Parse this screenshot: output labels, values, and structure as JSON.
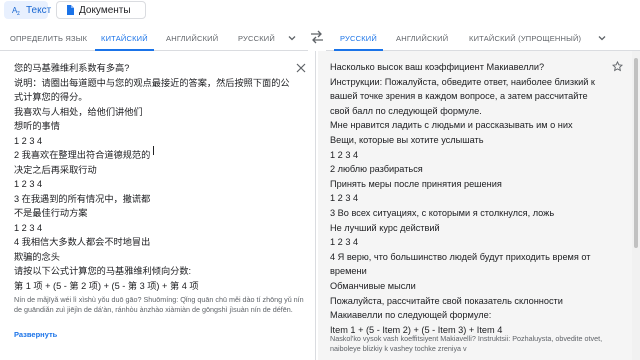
{
  "mode_buttons": {
    "text": "Текст",
    "documents": "Документы"
  },
  "source_langs": {
    "detect": "ОПРЕДЕЛИТЬ ЯЗЫК",
    "chinese": "КИТАЙСКИЙ",
    "english": "АНГЛИЙСКИЙ",
    "russian": "РУССКИЙ"
  },
  "target_langs": {
    "russian": "РУССКИЙ",
    "english": "АНГЛИЙСКИЙ",
    "chinese_simplified": "КИТАЙСКИЙ (УПРОЩЕННЫЙ)"
  },
  "source": {
    "lines": [
      "您的马基雅维利系数有多高?",
      "说明：请圈出每道题中与您的观点最接近的答案，然后按照下面的公",
      "式计算您的得分。",
      "我喜欢与人相处，给他们讲他们",
      "想听的事情",
      "1 2 3 4",
      "2 我喜欢在整理出符合道德规范的",
      "决定之后再采取行动",
      "1 2 3 4",
      "3 在我遇到的所有情况中，撒谎都",
      "不是最佳行动方案",
      "1 2 3 4",
      "4 我相信大多数人都会不时地冒出",
      "欺骗的念头",
      "请按以下公式计算您的马基雅维利倾向分数:",
      "第 1 项 + (5 - 第 2 项) + (5 - 第 3 项) + 第 4 项"
    ],
    "transliteration": "Nín de mǎjīyǎ wéi lì xìshù yǒu duō gāo? Shuōmíng: Qǐng quān chū měi dào tí zhōng yǔ nín de guāndiǎn zuì jiējìn de dá'àn, ránhòu ànzhào xiàmiàn de gōngshì jìsuàn nín de défēn.",
    "expand_label": "Развернуть"
  },
  "translation": {
    "lines": [
      "Насколько высок ваш коэффициент Макиавелли?",
      "Инструкции: Пожалуйста, обведите ответ, наиболее близкий к",
      "вашей точке зрения в каждом вопросе, а затем рассчитайте",
      "свой балл по следующей формуле.",
      "Мне нравится ладить с людьми и рассказывать им о них",
      "Вещи, которые вы хотите услышать",
      "1 2 3 4",
      "2 люблю разбираться",
      "Принять меры после принятия решения",
      "1 2 3 4",
      "3 Во всех ситуациях, с которыми я столкнулся, ложь",
      "Не лучший курс действий",
      "1 2 3 4",
      "4 Я верю, что большинство людей будут приходить время от",
      "времени",
      "Обманчивые мысли",
      "Пожалуйста, рассчитайте свой показатель склонности",
      "Макиавелли по следующей формуле:",
      "Item 1 + (5 - Item 2) + (5 - Item 3) + Item 4"
    ],
    "transliteration": "Naskol'ko vysok vash koeffitsiyent Makiavelli? Instruktsii: Pozhaluysta, obvedite otvet, naiboleye blizkiy k vashey tochke zreniya v"
  },
  "icons": {
    "text_mode": "translate-icon",
    "docs_mode": "document-icon",
    "swap": "swap-icon",
    "clear": "close-icon",
    "save": "star-icon"
  },
  "colors": {
    "accent": "#1a73e8",
    "output_bg": "#f5f5f5"
  }
}
